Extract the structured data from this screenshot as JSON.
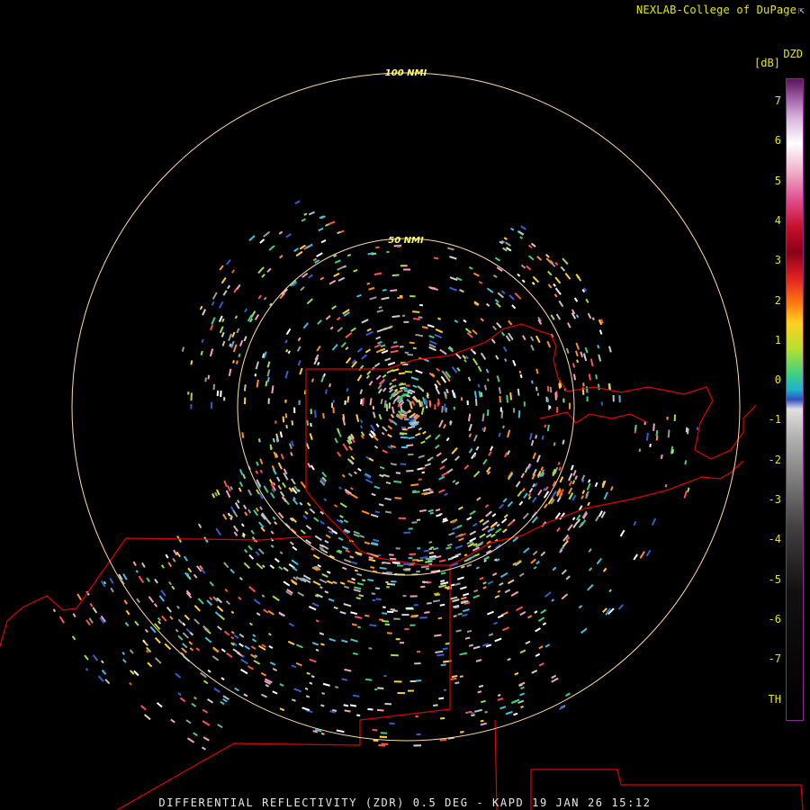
{
  "credit": {
    "text": "NEXLAB-College of DuPage",
    "icon": "external-link-icon"
  },
  "ring_labels": {
    "outer": "100 NMI",
    "inner": "50 NMI"
  },
  "colorbar": {
    "product": "DZD",
    "unit": "[dB]",
    "ticks": [
      "7",
      "6",
      "5",
      "4",
      "3",
      "2",
      "1",
      "0",
      "-1",
      "-2",
      "-3",
      "-4",
      "-5",
      "-6",
      "-7",
      "TH"
    ]
  },
  "footer": {
    "text": "DIFFERENTIAL REFLECTIVITY (ZDR) 0.5 DEG - KAPD 19 JAN 26 15:12"
  },
  "colors": {
    "range_ring": "#ffdca8",
    "border": "#e00000",
    "label_text": "#e6e600",
    "ring_label": "#ffff66"
  }
}
